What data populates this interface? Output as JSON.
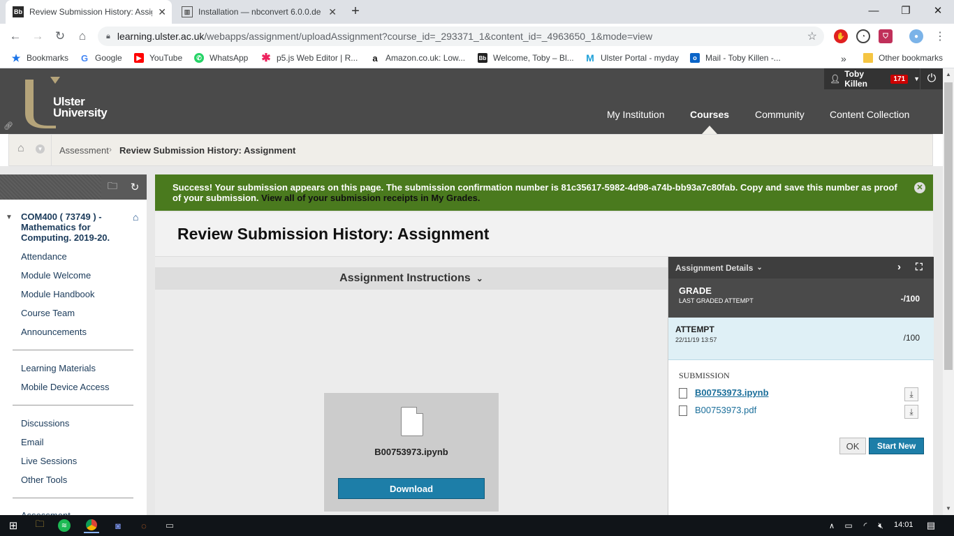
{
  "browser": {
    "tabs": [
      {
        "title": "Review Submission History: Assig",
        "favicon": "Bb"
      },
      {
        "title": "Installation — nbconvert 6.0.0.de",
        "favicon": "doc-icon"
      }
    ],
    "url_domain": "learning.ulster.ac.uk",
    "url_path": "/webapps/assignment/uploadAssignment?course_id=_293371_1&content_id=_4963650_1&mode=view",
    "bookmarks": [
      {
        "label": "Bookmarks",
        "icon": "star-icon"
      },
      {
        "label": "Google",
        "icon": "google-icon"
      },
      {
        "label": "YouTube",
        "icon": "youtube-icon"
      },
      {
        "label": "WhatsApp",
        "icon": "whatsapp-icon"
      },
      {
        "label": "p5.js Web Editor | R...",
        "icon": "p5-icon"
      },
      {
        "label": "Amazon.co.uk: Low...",
        "icon": "amazon-icon"
      },
      {
        "label": "Welcome, Toby – Bl...",
        "icon": "blackboard-icon"
      },
      {
        "label": "Ulster Portal - myday",
        "icon": "myday-icon"
      },
      {
        "label": "Mail - Toby Killen -...",
        "icon": "outlook-icon"
      }
    ],
    "bookmarks_more": "»",
    "other_bookmarks": "Other bookmarks"
  },
  "header": {
    "logo_line1": "Ulster",
    "logo_line2": "University",
    "user_name": "Toby Killen",
    "notification_count": "171",
    "nav": [
      "My Institution",
      "Courses",
      "Community",
      "Content Collection"
    ],
    "active_nav": "Courses"
  },
  "breadcrumb": {
    "parent": "Assessment",
    "current": "Review Submission History: Assignment"
  },
  "sidebar": {
    "course_title": "COM400 ( 73749 ) - Mathematics for Computing. 2019-20.",
    "group1": [
      "Attendance",
      "Module Welcome",
      "Module Handbook",
      "Course Team",
      "Announcements"
    ],
    "group2": [
      "Learning Materials",
      "Mobile Device Access"
    ],
    "group3": [
      "Discussions",
      "Email",
      "Live Sessions",
      "Other Tools"
    ],
    "partial_item": "Assessment"
  },
  "success": {
    "message": "Success! Your submission appears on this page. The submission confirmation number is 81c35617-5982-4d98-a74b-bb93a7c80fab. Copy and save this number as proof of your submission.",
    "link": "View all of your submission receipts in My Grades."
  },
  "page": {
    "title": "Review Submission History: Assignment",
    "instructions_label": "Assignment Instructions",
    "preview_file": "B00753973.ipynb",
    "download_label": "Download"
  },
  "details": {
    "header": "Assignment Details",
    "grade_label": "GRADE",
    "grade_sub": "LAST GRADED ATTEMPT",
    "grade_value": "-/100",
    "attempt_label": "ATTEMPT",
    "attempt_date": "22/11/19 13:57",
    "attempt_value": "/100",
    "submission_label": "SUBMISSION",
    "files": [
      "B00753973.ipynb",
      "B00753973.pdf"
    ],
    "ok_label": "OK",
    "start_new_label": "Start New"
  },
  "taskbar": {
    "time": "14:01"
  }
}
